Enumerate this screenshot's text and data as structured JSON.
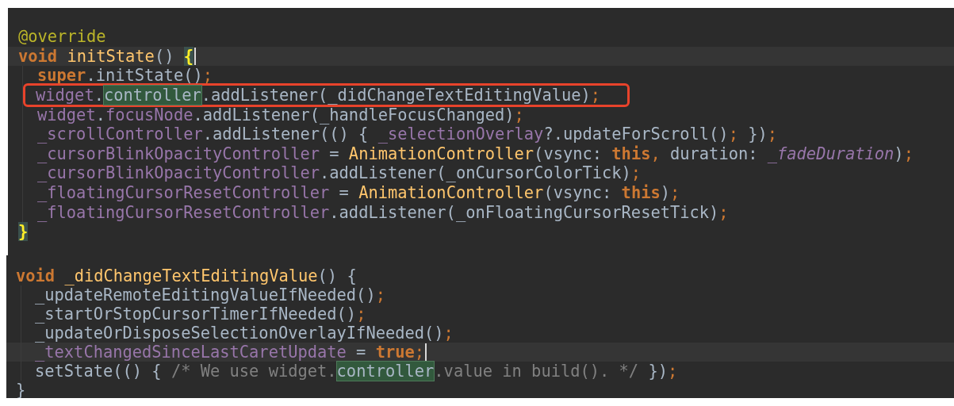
{
  "panels": [
    {
      "lines": [
        {
          "current": false,
          "caret": false,
          "indented": false,
          "boxed": false,
          "tokens": [
            {
              "text": "@override",
              "kind": "ann"
            }
          ]
        },
        {
          "current": true,
          "caret": true,
          "indented": false,
          "boxed": false,
          "tokens": [
            {
              "text": "void ",
              "kind": "kw"
            },
            {
              "text": "initState",
              "kind": "fn"
            },
            {
              "text": "() ",
              "kind": "plain"
            },
            {
              "text": "{",
              "kind": "brace"
            }
          ]
        },
        {
          "current": false,
          "caret": false,
          "indented": true,
          "boxed": false,
          "tokens": [
            {
              "text": "super",
              "kind": "kw"
            },
            {
              "text": ".initState()",
              "kind": "plain"
            },
            {
              "text": ";",
              "kind": "semi"
            }
          ]
        },
        {
          "current": false,
          "caret": false,
          "indented": true,
          "boxed": true,
          "tokens": [
            {
              "text": "widget",
              "kind": "field"
            },
            {
              "text": ".",
              "kind": "plain"
            },
            {
              "text": "controller",
              "kind": "usage"
            },
            {
              "text": ".addListener(_didChangeTextEditingValue)",
              "kind": "plain"
            },
            {
              "text": ";",
              "kind": "semi"
            }
          ]
        },
        {
          "current": false,
          "caret": false,
          "indented": true,
          "boxed": false,
          "tokens": [
            {
              "text": "widget",
              "kind": "field"
            },
            {
              "text": ".",
              "kind": "plain"
            },
            {
              "text": "focusNode",
              "kind": "field"
            },
            {
              "text": ".addListener(_handleFocusChanged)",
              "kind": "plain"
            },
            {
              "text": ";",
              "kind": "semi"
            }
          ]
        },
        {
          "current": false,
          "caret": false,
          "indented": true,
          "boxed": false,
          "tokens": [
            {
              "text": "_scrollController",
              "kind": "field"
            },
            {
              "text": ".addListener(() { ",
              "kind": "plain"
            },
            {
              "text": "_selectionOverlay",
              "kind": "field"
            },
            {
              "text": "?.updateForScroll()",
              "kind": "plain"
            },
            {
              "text": ";",
              "kind": "semi"
            },
            {
              "text": " })",
              "kind": "plain"
            },
            {
              "text": ";",
              "kind": "semi"
            }
          ]
        },
        {
          "current": false,
          "caret": false,
          "indented": true,
          "boxed": false,
          "tokens": [
            {
              "text": "_cursorBlinkOpacityController",
              "kind": "field"
            },
            {
              "text": " = ",
              "kind": "plain"
            },
            {
              "text": "AnimationController",
              "kind": "fn"
            },
            {
              "text": "(vsync: ",
              "kind": "plain"
            },
            {
              "text": "this",
              "kind": "kw"
            },
            {
              "text": ",",
              "kind": "semi"
            },
            {
              "text": " duration: ",
              "kind": "plain"
            },
            {
              "text": "_fadeDuration",
              "kind": "static"
            },
            {
              "text": ")",
              "kind": "plain"
            },
            {
              "text": ";",
              "kind": "semi"
            }
          ]
        },
        {
          "current": false,
          "caret": false,
          "indented": true,
          "boxed": false,
          "tokens": [
            {
              "text": "_cursorBlinkOpacityController",
              "kind": "field"
            },
            {
              "text": ".addListener(_onCursorColorTick)",
              "kind": "plain"
            },
            {
              "text": ";",
              "kind": "semi"
            }
          ]
        },
        {
          "current": false,
          "caret": false,
          "indented": true,
          "boxed": false,
          "tokens": [
            {
              "text": "_floatingCursorResetController",
              "kind": "field"
            },
            {
              "text": " = ",
              "kind": "plain"
            },
            {
              "text": "AnimationController",
              "kind": "fn"
            },
            {
              "text": "(vsync: ",
              "kind": "plain"
            },
            {
              "text": "this",
              "kind": "kw"
            },
            {
              "text": ")",
              "kind": "plain"
            },
            {
              "text": ";",
              "kind": "semi"
            }
          ]
        },
        {
          "current": false,
          "caret": false,
          "indented": true,
          "boxed": false,
          "tokens": [
            {
              "text": "_floatingCursorResetController",
              "kind": "field"
            },
            {
              "text": ".addListener(_onFloatingCursorResetTick)",
              "kind": "plain"
            },
            {
              "text": ";",
              "kind": "semi"
            }
          ]
        },
        {
          "current": false,
          "caret": false,
          "indented": false,
          "boxed": false,
          "tokens": [
            {
              "text": "}",
              "kind": "brace"
            }
          ]
        }
      ]
    },
    {
      "lines": [
        {
          "current": false,
          "caret": false,
          "indented": false,
          "boxed": false,
          "tokens": [
            {
              "text": "void ",
              "kind": "kw"
            },
            {
              "text": "_didChangeTextEditingValue",
              "kind": "fn"
            },
            {
              "text": "() {",
              "kind": "plain"
            }
          ]
        },
        {
          "current": false,
          "caret": false,
          "indented": true,
          "boxed": false,
          "tokens": [
            {
              "text": "_updateRemoteEditingValueIfNeeded()",
              "kind": "plain"
            },
            {
              "text": ";",
              "kind": "semi"
            }
          ]
        },
        {
          "current": false,
          "caret": false,
          "indented": true,
          "boxed": false,
          "tokens": [
            {
              "text": "_startOrStopCursorTimerIfNeeded()",
              "kind": "plain"
            },
            {
              "text": ";",
              "kind": "semi"
            }
          ]
        },
        {
          "current": false,
          "caret": false,
          "indented": true,
          "boxed": false,
          "tokens": [
            {
              "text": "_updateOrDisposeSelectionOverlayIfNeeded()",
              "kind": "plain"
            },
            {
              "text": ";",
              "kind": "semi"
            }
          ]
        },
        {
          "current": true,
          "caret": true,
          "indented": true,
          "boxed": false,
          "tokens": [
            {
              "text": "_textChangedSinceLastCaretUpdate",
              "kind": "field"
            },
            {
              "text": " = ",
              "kind": "plain"
            },
            {
              "text": "true",
              "kind": "kw"
            },
            {
              "text": ";",
              "kind": "semi"
            }
          ]
        },
        {
          "current": false,
          "caret": false,
          "indented": true,
          "boxed": false,
          "tokens": [
            {
              "text": "setState(() { ",
              "kind": "plain"
            },
            {
              "text": "/* We use widget.",
              "kind": "comment"
            },
            {
              "text": "controller",
              "kind": "usage"
            },
            {
              "text": ".value in build(). */",
              "kind": "comment"
            },
            {
              "text": " })",
              "kind": "plain"
            },
            {
              "text": ";",
              "kind": "semi"
            }
          ]
        },
        {
          "current": false,
          "caret": false,
          "indented": false,
          "boxed": false,
          "tokens": [
            {
              "text": "}",
              "kind": "plain"
            }
          ]
        }
      ]
    }
  ]
}
